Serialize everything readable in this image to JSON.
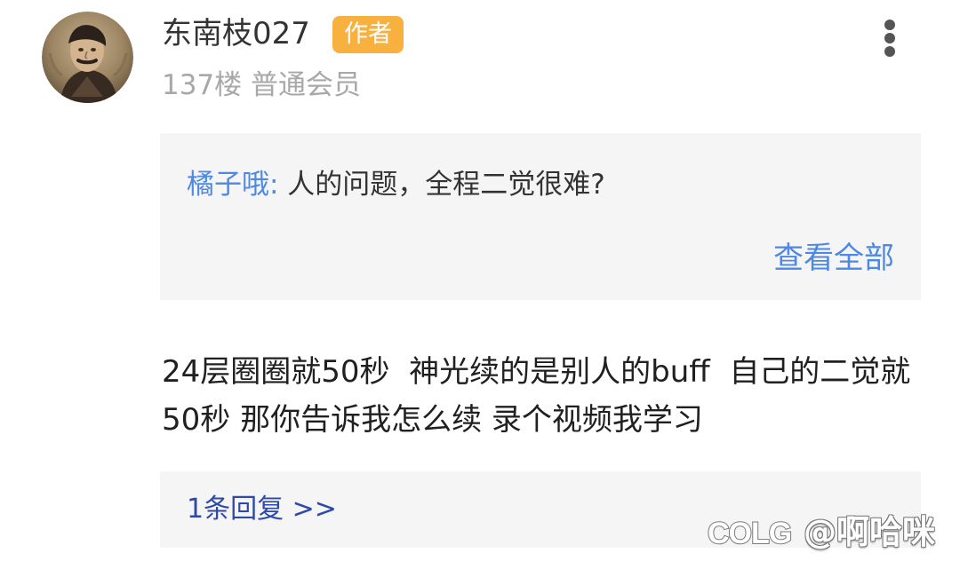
{
  "post": {
    "username": "东南枝027",
    "author_badge": "作者",
    "floor": "137楼",
    "member_level": "普通会员",
    "more_icon": "more-vertical-icon",
    "avatar_icon": "user-avatar-portrait"
  },
  "quote": {
    "author": "橘子哦:",
    "text": " 人的问题，全程二觉很难?",
    "view_all": "查看全部"
  },
  "content": {
    "text": "24层圈圈就50秒  神光续的是别人的buff  自己的二觉就50秒 那你告诉我怎么续 录个视频我学习"
  },
  "replies": {
    "label": "1条回复 >>"
  },
  "watermark": {
    "logo_text": "COLG",
    "text": "@啊哈咪"
  },
  "colors": {
    "badge": "#f8b13f",
    "link_blue": "#4d88e5",
    "reply_blue": "#2e49a8",
    "box_background": "#f5f5f5"
  }
}
